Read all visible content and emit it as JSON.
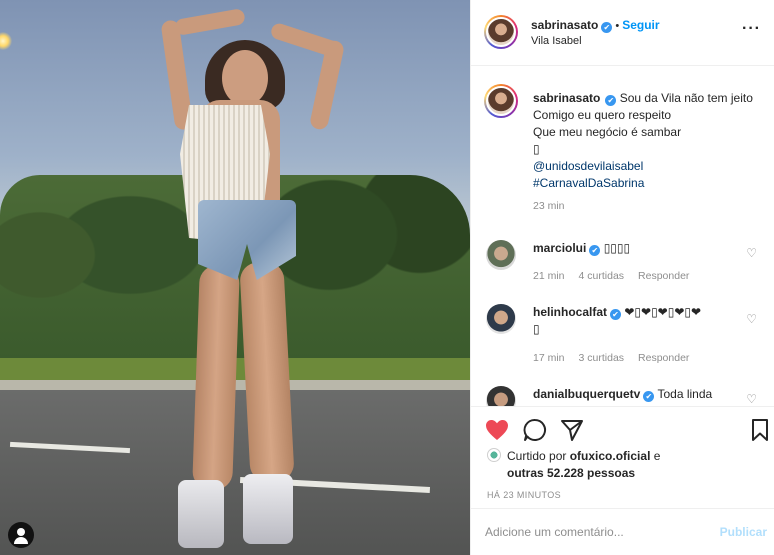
{
  "post_author": {
    "username": "sabrinasato",
    "verified_mark": "✔",
    "separator": "•",
    "follow_label": "Seguir",
    "location": "Vila Isabel",
    "more_label": "···"
  },
  "caption": {
    "username": "sabrinasato",
    "line1": "Sou da Vila não tem jeito",
    "line2": "Comigo eu quero respeito",
    "line3": "Que meu negócio é sambar",
    "line4": "▯",
    "mention": "@unidosdevilaisabel",
    "hashtag": "#CarnavalDaSabrina",
    "time": "23 min"
  },
  "comments": [
    {
      "username": "marciolui",
      "text": "▯▯▯▯",
      "time": "21 min",
      "likes": "4 curtidas",
      "reply_label": "Responder"
    },
    {
      "username": "helinhocalfat",
      "text": "❤▯❤▯❤▯❤▯❤",
      "text2": "▯",
      "time": "17 min",
      "likes": "3 curtidas",
      "reply_label": "Responder"
    },
    {
      "username": "danialbuquerquetv",
      "text": "Toda linda"
    }
  ],
  "actions": {
    "liked_by_prefix": "Curtido por",
    "liked_by_user": "ofuxico.oficial",
    "liked_by_and": "e",
    "others": "outras 52.228 pessoas",
    "time_ago": "HÁ 23 MINUTOS"
  },
  "comment_box": {
    "placeholder": "Adicione um comentário...",
    "publish_label": "Publicar"
  },
  "colors": {
    "accent": "#0095f6",
    "like_red": "#ed4956",
    "verified": "#3897f0",
    "muted": "#8e8e8e"
  },
  "icons": [
    "heart-icon",
    "comment-icon",
    "share-icon",
    "bookmark-icon",
    "user-tag-icon"
  ]
}
